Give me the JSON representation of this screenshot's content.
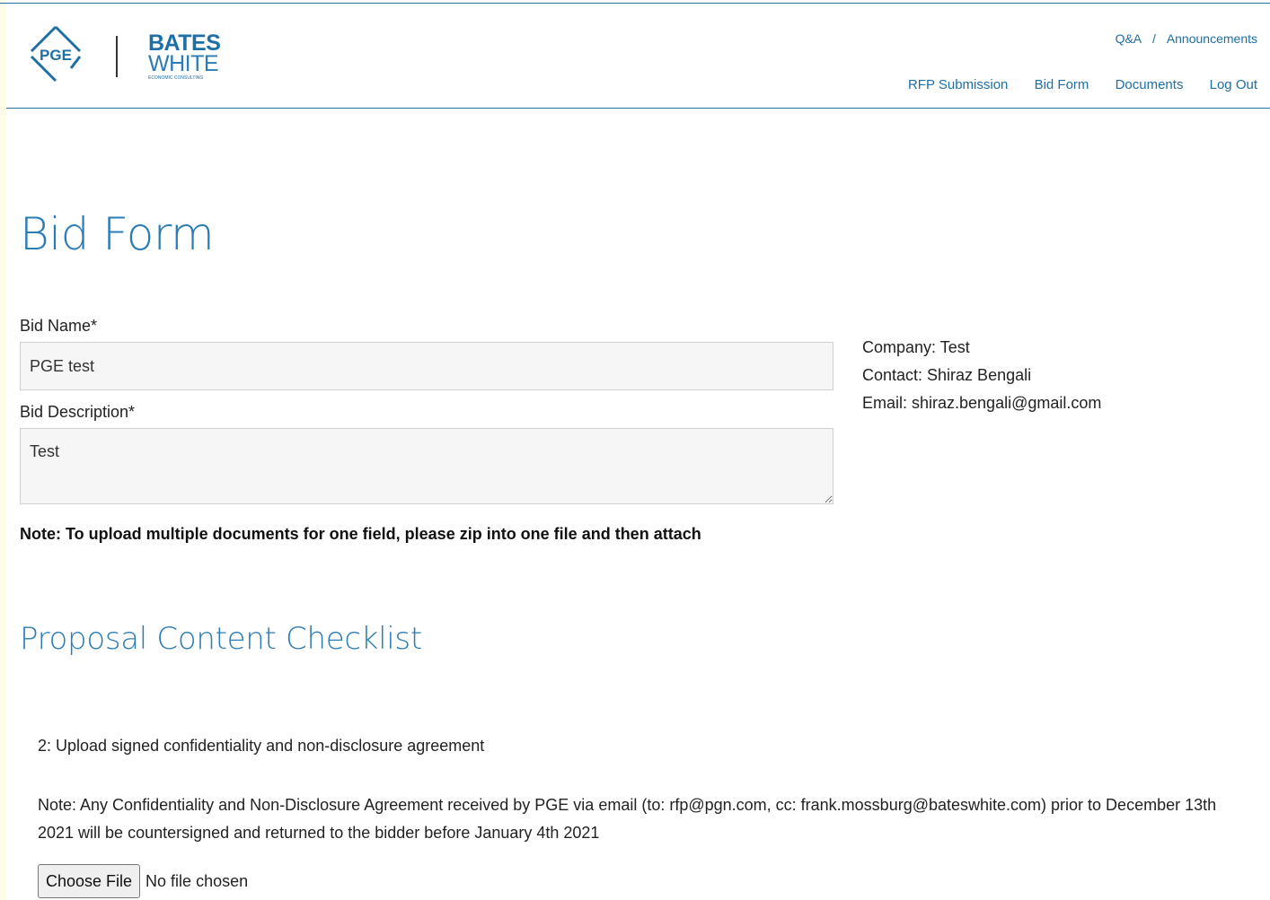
{
  "header": {
    "pge_logo_text": "PGE",
    "partner_logo": {
      "line1": "BATES",
      "line2": "WHITE",
      "tagline": "ECONOMIC CONSULTING"
    },
    "util_links": {
      "qa": "Q&A",
      "separator": "/",
      "announcements": "Announcements"
    },
    "nav": {
      "rfp_submission": "RFP Submission",
      "bid_form": "Bid Form",
      "documents": "Documents",
      "log_out": "Log Out"
    }
  },
  "page": {
    "title": "Bid Form"
  },
  "form": {
    "bid_name_label": "Bid Name*",
    "bid_name_value": "PGE test",
    "bid_description_label": "Bid Description*",
    "bid_description_value": "Test",
    "upload_note": "Note: To upload multiple documents for one field, please zip into one file and then attach"
  },
  "company_info": {
    "company": "Company: Test",
    "contact": "Contact: Shiraz Bengali",
    "email": "Email: shiraz.bengali@gmail.com"
  },
  "checklist": {
    "section_title": "Proposal Content Checklist",
    "item_title": "2: Upload signed confidentiality and non-disclosure agreement",
    "item_note": "Note: Any Confidentiality and Non-Disclosure Agreement received by PGE via email (to: rfp@pgn.com, cc: frank.mossburg@bateswhite.com) prior to December 13th 2021 will be countersigned and returned to the bidder before January 4th 2021",
    "choose_file_label": "Choose File",
    "file_status": "No file chosen"
  },
  "colors": {
    "accent": "#2b7cb4",
    "link": "#1d6fa5",
    "input_background": "#f6f6f6"
  }
}
